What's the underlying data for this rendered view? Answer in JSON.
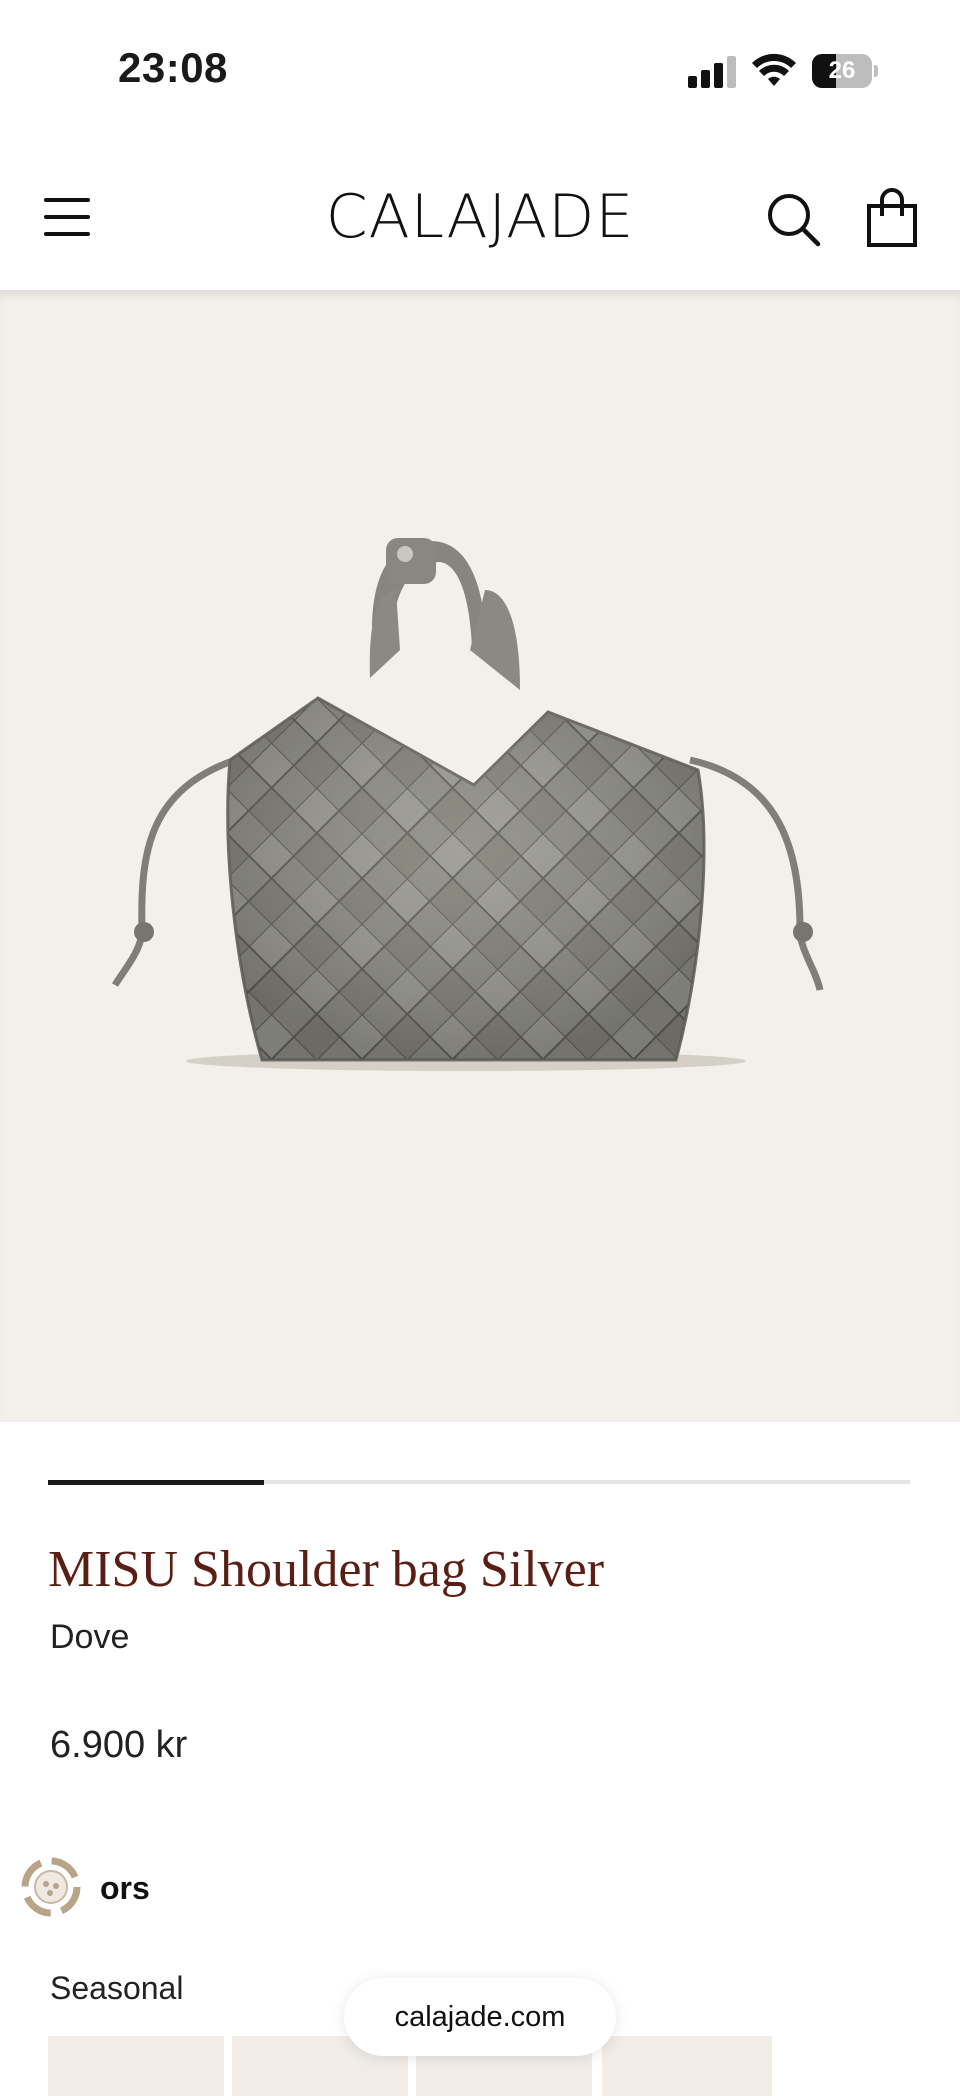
{
  "status_bar": {
    "time": "23:08",
    "battery": "26",
    "signal_icon": "cellular-signal-icon",
    "wifi_icon": "wifi-icon",
    "battery_icon": "battery-icon"
  },
  "header": {
    "logo": "CALAJADE",
    "menu_icon": "hamburger-menu-icon",
    "search_icon": "search-icon",
    "bag_icon": "shopping-bag-icon"
  },
  "product": {
    "title": "MISU Shoulder bag Silver",
    "color": "Dove",
    "price": "6.900 kr",
    "image_background": "#f3efea",
    "bag_color": "#8c8b84",
    "title_color": "#5a1f14"
  },
  "carousel": {
    "current_slide_fraction": 0.25
  },
  "colors_section": {
    "label": "ors",
    "loading_icon": "loading-spinner-icon"
  },
  "seasonal": {
    "label": "Seasonal",
    "thumbnails_visible": 4
  },
  "browser": {
    "url": "calajade.com"
  }
}
